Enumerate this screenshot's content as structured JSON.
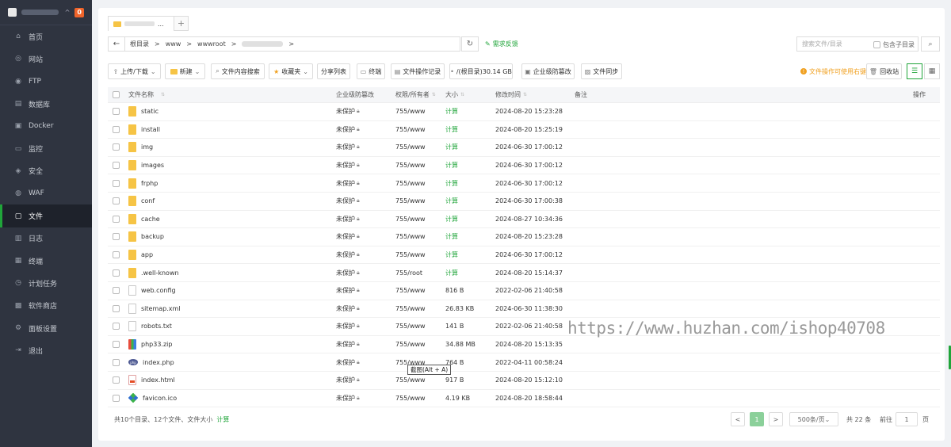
{
  "sidebar": {
    "badge": "0",
    "items": [
      {
        "label": "首页",
        "icon": "home-icon",
        "glyph": "⌂",
        "active": false
      },
      {
        "label": "网站",
        "icon": "globe-icon",
        "glyph": "◎",
        "active": false
      },
      {
        "label": "FTP",
        "icon": "ftp-icon",
        "glyph": "◉",
        "active": false
      },
      {
        "label": "数据库",
        "icon": "database-icon",
        "glyph": "▤",
        "active": false
      },
      {
        "label": "Docker",
        "icon": "docker-icon",
        "glyph": "▣",
        "active": false
      },
      {
        "label": "监控",
        "icon": "monitor-icon",
        "glyph": "▭",
        "active": false
      },
      {
        "label": "安全",
        "icon": "shield-icon",
        "glyph": "◈",
        "active": false
      },
      {
        "label": "WAF",
        "icon": "waf-icon",
        "glyph": "◍",
        "active": false
      },
      {
        "label": "文件",
        "icon": "folder-icon",
        "glyph": "▢",
        "active": true
      },
      {
        "label": "日志",
        "icon": "log-icon",
        "glyph": "▥",
        "active": false
      },
      {
        "label": "终端",
        "icon": "terminal-icon",
        "glyph": "▦",
        "active": false
      },
      {
        "label": "计划任务",
        "icon": "schedule-icon",
        "glyph": "◷",
        "active": false
      },
      {
        "label": "软件商店",
        "icon": "store-icon",
        "glyph": "▩",
        "active": false
      },
      {
        "label": "面板设置",
        "icon": "settings-icon",
        "glyph": "⚙",
        "active": false
      },
      {
        "label": "退出",
        "icon": "logout-icon",
        "glyph": "⇥",
        "active": false
      }
    ]
  },
  "tabs": {
    "active_suffix": "...",
    "add": "+"
  },
  "path": {
    "segments": [
      "根目录",
      "www",
      "wwwroot"
    ],
    "sep": ">",
    "feedback": "需求反馈"
  },
  "search": {
    "placeholder": "搜索文件/目录",
    "sub_label": "包含子目录"
  },
  "toolbar": {
    "upload": "上传/下载",
    "new": "新建",
    "content_search": "文件内容搜索",
    "favorites": "收藏夹",
    "share_list": "分享列表",
    "terminal": "终端",
    "op_log": "文件操作记录",
    "disk": "/(根目录)30.14 GB",
    "enterprise": "企业级防篡改",
    "sync": "文件同步",
    "right_click_tip": "文件操作可使用右键",
    "recycle": "回收站"
  },
  "table": {
    "headers": {
      "name": "文件名称",
      "protect": "企业级防篡改",
      "perm": "权限/所有者",
      "size": "大小",
      "time": "修改时间",
      "note": "备注",
      "action": "操作"
    },
    "rows": [
      {
        "name": "static",
        "type": "folder",
        "protect": "未保护",
        "perm": "755/www",
        "size": "计算",
        "time": "2024-08-20 15:23:28"
      },
      {
        "name": "install",
        "type": "folder",
        "protect": "未保护",
        "perm": "755/www",
        "size": "计算",
        "time": "2024-08-20 15:25:19"
      },
      {
        "name": "img",
        "type": "folder",
        "protect": "未保护",
        "perm": "755/www",
        "size": "计算",
        "time": "2024-06-30 17:00:12"
      },
      {
        "name": "images",
        "type": "folder",
        "protect": "未保护",
        "perm": "755/www",
        "size": "计算",
        "time": "2024-06-30 17:00:12"
      },
      {
        "name": "frphp",
        "type": "folder",
        "protect": "未保护",
        "perm": "755/www",
        "size": "计算",
        "time": "2024-06-30 17:00:12"
      },
      {
        "name": "conf",
        "type": "folder",
        "protect": "未保护",
        "perm": "755/www",
        "size": "计算",
        "time": "2024-06-30 17:00:38"
      },
      {
        "name": "cache",
        "type": "folder",
        "protect": "未保护",
        "perm": "755/www",
        "size": "计算",
        "time": "2024-08-27 10:34:36"
      },
      {
        "name": "backup",
        "type": "folder",
        "protect": "未保护",
        "perm": "755/www",
        "size": "计算",
        "time": "2024-08-20 15:23:28"
      },
      {
        "name": "app",
        "type": "folder",
        "protect": "未保护",
        "perm": "755/www",
        "size": "计算",
        "time": "2024-06-30 17:00:12"
      },
      {
        "name": ".well-known",
        "type": "folder",
        "protect": "未保护",
        "perm": "755/root",
        "size": "计算",
        "time": "2024-08-20 15:14:37"
      },
      {
        "name": "web.config",
        "type": "doc",
        "protect": "未保护",
        "perm": "755/www",
        "size": "816 B",
        "time": "2022-02-06 21:40:58"
      },
      {
        "name": "sitemap.xml",
        "type": "doc",
        "protect": "未保护",
        "perm": "755/www",
        "size": "26.83 KB",
        "time": "2024-06-30 11:38:30"
      },
      {
        "name": "robots.txt",
        "type": "doc",
        "protect": "未保护",
        "perm": "755/www",
        "size": "141 B",
        "time": "2022-02-06 21:40:58"
      },
      {
        "name": "php33.zip",
        "type": "zip",
        "protect": "未保护",
        "perm": "755/www",
        "size": "34.88 MB",
        "time": "2024-08-20 15:13:35"
      },
      {
        "name": "index.php",
        "type": "php",
        "protect": "未保护",
        "perm": "755/www",
        "size": "764 B",
        "time": "2022-04-11 00:58:24"
      },
      {
        "name": "index.html",
        "type": "html",
        "protect": "未保护",
        "perm": "755/www",
        "size": "917 B",
        "time": "2024-08-20 15:12:10"
      },
      {
        "name": "favicon.ico",
        "type": "ico",
        "protect": "未保护",
        "perm": "755/www",
        "size": "4.19 KB",
        "time": "2024-08-20 18:58:44"
      }
    ]
  },
  "footer": {
    "summary": "共10个目录、12个文件、文件大小",
    "calc": "计算",
    "prev": "<",
    "current_page": "1",
    "next": ">",
    "page_size": "500条/页",
    "total": "共 22 条",
    "goto_label": "前往",
    "goto_value": "1",
    "page_unit": "页"
  },
  "tooltip": "截图(Alt + A)",
  "watermark": "https://www.huzhan.com/ishop40708"
}
